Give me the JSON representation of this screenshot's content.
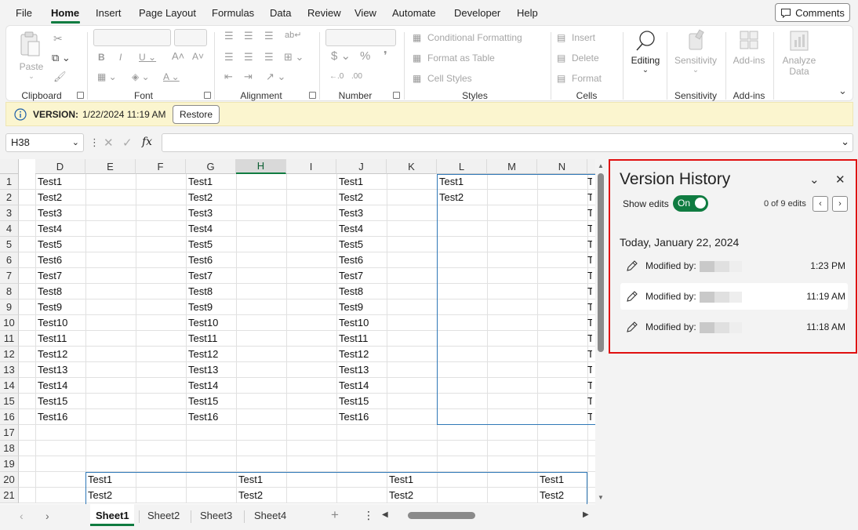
{
  "menu": {
    "items": [
      "File",
      "Home",
      "Insert",
      "Page Layout",
      "Formulas",
      "Data",
      "Review",
      "View",
      "Automate",
      "Developer",
      "Help"
    ],
    "active": "Home",
    "comments_label": "Comments"
  },
  "ribbon": {
    "clipboard": {
      "label": "Clipboard",
      "paste": "Paste"
    },
    "font": {
      "label": "Font"
    },
    "alignment": {
      "label": "Alignment"
    },
    "number": {
      "label": "Number"
    },
    "styles": {
      "label": "Styles",
      "conditional": "Conditional Formatting",
      "table": "Format as Table",
      "cell_styles": "Cell Styles"
    },
    "cells": {
      "label": "Cells",
      "insert": "Insert",
      "delete": "Delete",
      "format": "Format"
    },
    "editing": {
      "label": "Editing"
    },
    "sensitivity": {
      "label": "Sensitivity",
      "button": "Sensitivity"
    },
    "addins": {
      "label": "Add-ins",
      "button": "Add-ins"
    },
    "analyze": {
      "line1": "Analyze",
      "line2": "Data"
    }
  },
  "version_bar": {
    "label": "VERSION:",
    "timestamp": "1/22/2024 11:19 AM",
    "restore": "Restore"
  },
  "formula_bar": {
    "name_box": "H38",
    "fx": "fx",
    "value": ""
  },
  "sheet": {
    "columns": [
      "D",
      "E",
      "F",
      "G",
      "H",
      "I",
      "J",
      "K",
      "L",
      "M",
      "N"
    ],
    "selected_column": "H",
    "rows": [
      "1",
      "2",
      "3",
      "4",
      "5",
      "6",
      "7",
      "8",
      "9",
      "10",
      "11",
      "12",
      "13",
      "14",
      "15",
      "16",
      "17",
      "18",
      "19",
      "20",
      "21"
    ],
    "d_col": [
      "Test1",
      "Test2",
      "Test3",
      "Test4",
      "Test5",
      "Test6",
      "Test7",
      "Test8",
      "Test9",
      "Test10",
      "Test11",
      "Test12",
      "Test13",
      "Test14",
      "Test15",
      "Test16"
    ],
    "g_col": [
      "Test1",
      "Test2",
      "Test3",
      "Test4",
      "Test5",
      "Test6",
      "Test7",
      "Test8",
      "Test9",
      "Test10",
      "Test11",
      "Test12",
      "Test13",
      "Test14",
      "Test15",
      "Test16"
    ],
    "j_col": [
      "Test1",
      "Test2",
      "Test3",
      "Test4",
      "Test5",
      "Test6",
      "Test7",
      "Test8",
      "Test9",
      "Test10",
      "Test11",
      "Test12",
      "Test13",
      "Test14",
      "Test15",
      "Test16"
    ],
    "l_col": [
      "Test1",
      "Test2"
    ],
    "row20": [
      "Test1",
      "Test1",
      "Test1",
      "Test1"
    ],
    "row21": [
      "Test2",
      "Test2",
      "Test2",
      "Test2"
    ],
    "tabs": [
      "Sheet1",
      "Sheet2",
      "Sheet3",
      "Sheet4"
    ],
    "active_tab": "Sheet1"
  },
  "version_history": {
    "title": "Version History",
    "show_edits_label": "Show edits",
    "toggle_label": "On",
    "edits_counter": "0 of 9 edits",
    "date_heading": "Today, January 22, 2024",
    "entries": [
      {
        "label": "Modified by:",
        "time": "1:23 PM"
      },
      {
        "label": "Modified by:",
        "time": "11:19 AM"
      },
      {
        "label": "Modified by:",
        "time": "11:18 AM"
      }
    ],
    "highlight_color": "#e01010",
    "toggle_color": "#107c41"
  }
}
